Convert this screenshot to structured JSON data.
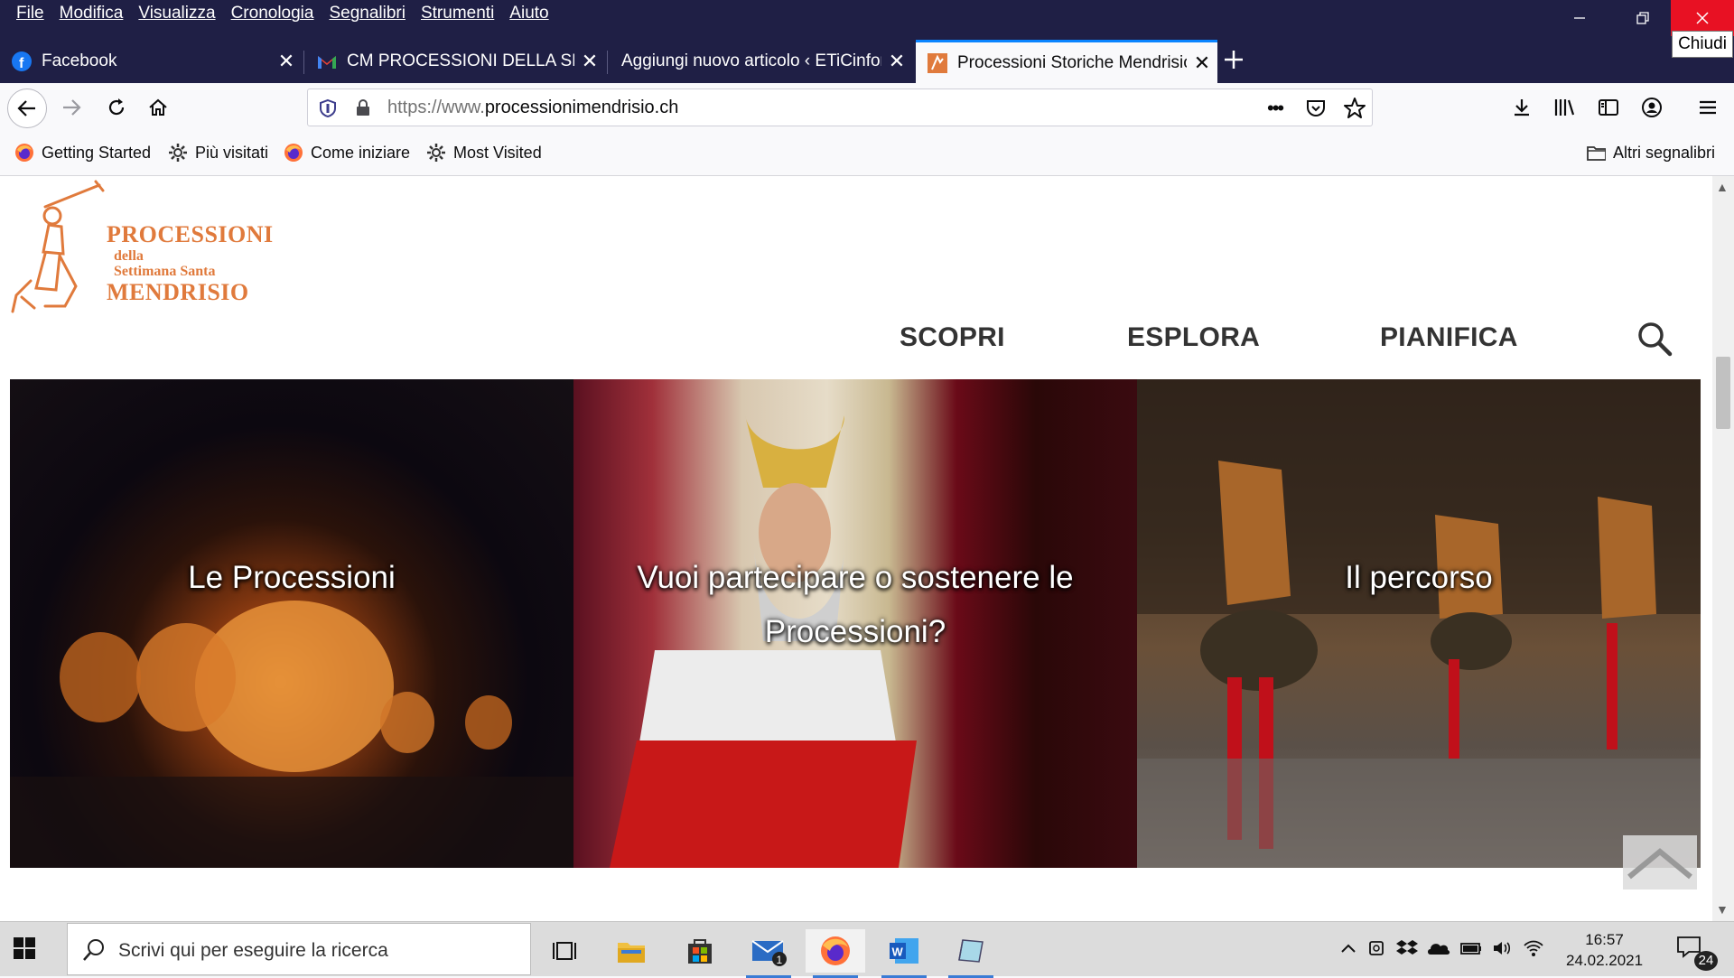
{
  "window": {
    "menu": [
      "File",
      "Modifica",
      "Visualizza",
      "Cronologia",
      "Segnalibri",
      "Strumenti",
      "Aiuto"
    ],
    "close_tooltip": "Chiudi"
  },
  "tabs": [
    {
      "title": "Facebook",
      "favicon": "facebook-icon"
    },
    {
      "title": "CM PROCESSIONI DELLA SETTIMANA SANTA",
      "favicon": "gmail-icon"
    },
    {
      "title": "Aggiungi nuovo articolo ‹ ETiCinforma",
      "favicon": "none"
    },
    {
      "title": "Processioni Storiche Mendrisio",
      "favicon": "processioni-favicon",
      "active": true
    }
  ],
  "navbar": {
    "url_prefix": "https://www.",
    "url_domain": "processionimendrisio.ch"
  },
  "bookmarks": {
    "items": [
      {
        "label": "Getting Started",
        "icon": "firefox-icon"
      },
      {
        "label": "Più visitati",
        "icon": "gear-icon"
      },
      {
        "label": "Come iniziare",
        "icon": "firefox-icon"
      },
      {
        "label": "Most Visited",
        "icon": "gear-icon"
      }
    ],
    "other": "Altri segnalibri"
  },
  "site": {
    "logo": {
      "line1": "PROCESSIONI",
      "line2": "della",
      "line3": "Settimana Santa",
      "line4": "MENDRISIO"
    },
    "nav": [
      "SCOPRI",
      "ESPLORA",
      "PIANIFICA"
    ],
    "heroes": [
      {
        "title": "Le Processioni"
      },
      {
        "title": "Vuoi partecipare o sostenere le Processioni?"
      },
      {
        "title": "Il percorso"
      }
    ]
  },
  "taskbar": {
    "search_placeholder": "Scrivi qui per eseguire la ricerca",
    "mail_badge": "1",
    "time": "16:57",
    "date": "24.02.2021",
    "notifications": "24"
  },
  "colors": {
    "titlebar": "#1f1f45",
    "accent": "#0a84ff",
    "logo": "#e07a3c"
  }
}
